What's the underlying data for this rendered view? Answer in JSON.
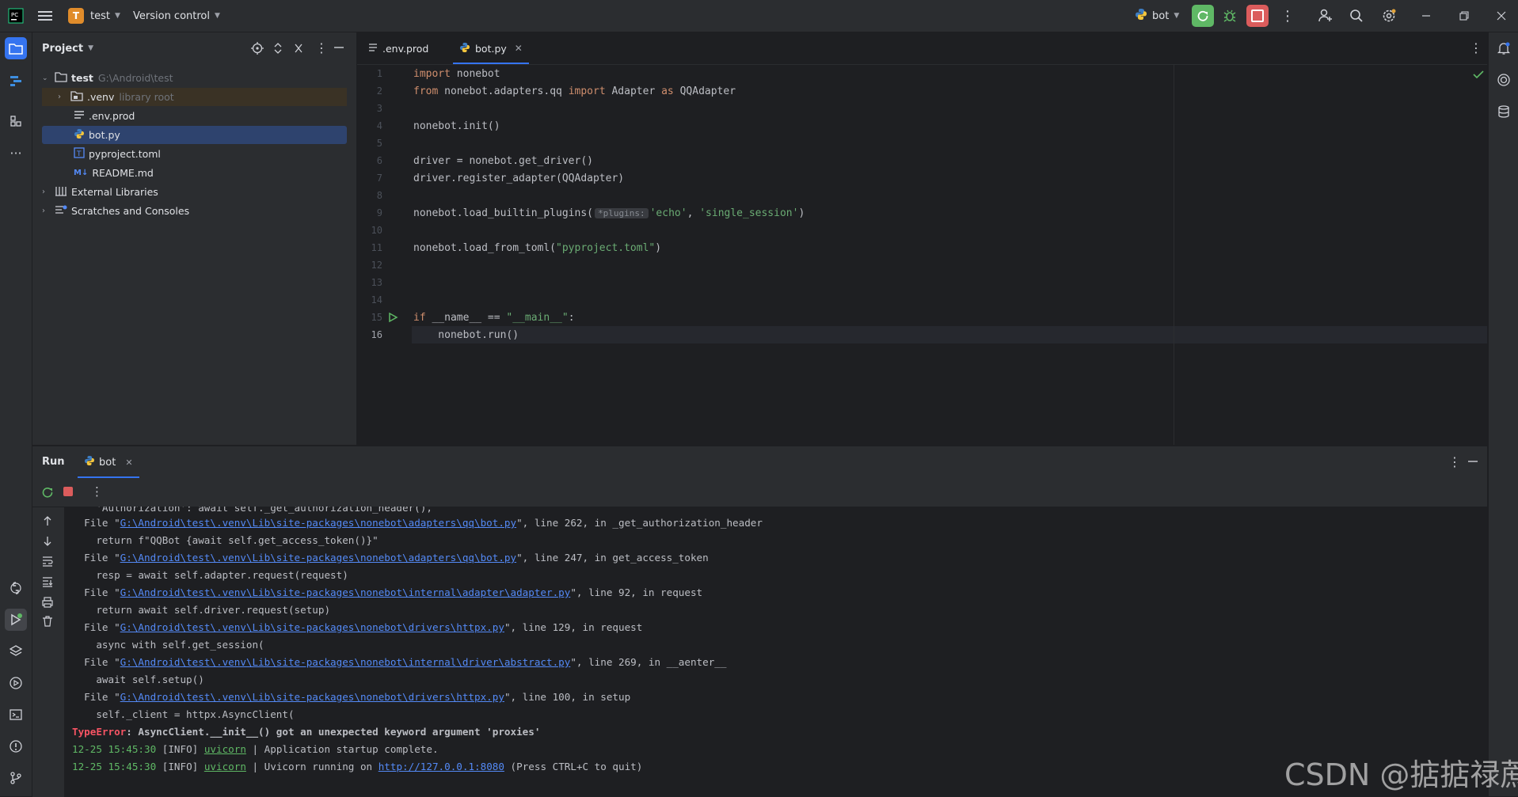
{
  "titlebar": {
    "project_initial": "T",
    "project_name": "test",
    "vcs_label": "Version control",
    "run_config": "bot"
  },
  "project_panel": {
    "title": "Project",
    "tree": [
      {
        "label": "test",
        "hint": "G:\\Android\\test"
      },
      {
        "label": ".venv",
        "hint": "library root"
      },
      {
        "label": ".env.prod"
      },
      {
        "label": "bot.py"
      },
      {
        "label": "pyproject.toml"
      },
      {
        "label": "README.md"
      },
      {
        "label": "External Libraries"
      },
      {
        "label": "Scratches and Consoles"
      }
    ]
  },
  "editor": {
    "tabs": [
      {
        "label": ".env.prod"
      },
      {
        "label": "bot.py"
      }
    ],
    "line_numbers": [
      "1",
      "2",
      "3",
      "4",
      "5",
      "6",
      "7",
      "8",
      "9",
      "10",
      "11",
      "12",
      "13",
      "14",
      "15",
      "16"
    ],
    "lines": {
      "l1_kw": "import",
      "l1_rest": " nonebot",
      "l2_kw": "from",
      "l2_mid": " nonebot.adapters.qq ",
      "l2_kw2": "import",
      "l2_mid2": " Adapter ",
      "l2_kw3": "as",
      "l2_end": " QQAdapter",
      "l4": "nonebot.init()",
      "l6": "driver = nonebot.get_driver()",
      "l7": "driver.register_adapter(QQAdapter)",
      "l9_a": "nonebot.load_builtin_plugins(",
      "l9_hint": "*plugins:",
      "l9_s1": "'echo'",
      "l9_c": ", ",
      "l9_s2": "'single_session'",
      "l9_end": ")",
      "l11_a": "nonebot.load_from_toml(",
      "l11_s": "\"pyproject.toml\"",
      "l11_end": ")",
      "l15_kw": "if",
      "l15_mid": " __name__ == ",
      "l15_s": "\"__main__\"",
      "l15_end": ":",
      "l16": "    nonebot.run()"
    }
  },
  "run_panel": {
    "title": "Run",
    "tab_label": "bot",
    "console": {
      "l0": "    'Authorization': await self._get_authorization_header(),",
      "f1_pre": "  File \"",
      "f1_path": "G:\\Android\\test\\.venv\\Lib\\site-packages\\nonebot\\adapters\\qq\\bot.py",
      "f1_post": "\", line 262, in _get_authorization_header",
      "l2": "    return f\"QQBot {await self.get_access_token()}\"",
      "f2_pre": "  File \"",
      "f2_path": "G:\\Android\\test\\.venv\\Lib\\site-packages\\nonebot\\adapters\\qq\\bot.py",
      "f2_post": "\", line 247, in get_access_token",
      "l4": "    resp = await self.adapter.request(request)",
      "f3_pre": "  File \"",
      "f3_path": "G:\\Android\\test\\.venv\\Lib\\site-packages\\nonebot\\internal\\adapter\\adapter.py",
      "f3_post": "\", line 92, in request",
      "l6": "    return await self.driver.request(setup)",
      "f4_pre": "  File \"",
      "f4_path": "G:\\Android\\test\\.venv\\Lib\\site-packages\\nonebot\\drivers\\httpx.py",
      "f4_post": "\", line 129, in request",
      "l8": "    async with self.get_session(",
      "f5_pre": "  File \"",
      "f5_path": "G:\\Android\\test\\.venv\\Lib\\site-packages\\nonebot\\internal\\driver\\abstract.py",
      "f5_post": "\", line 269, in __aenter__",
      "l10": "    await self.setup()",
      "f6_pre": "  File \"",
      "f6_path": "G:\\Android\\test\\.venv\\Lib\\site-packages\\nonebot\\drivers\\httpx.py",
      "f6_post": "\", line 100, in setup",
      "l12": "    self._client = httpx.AsyncClient(",
      "err_type": "TypeError",
      "err_msg": ": AsyncClient.__init__() got an unexpected keyword argument 'proxies'",
      "i1_time": "12-25 15:45:30",
      "i1_level": " [INFO] ",
      "i1_src": "uvicorn",
      "i1_msg": " | Application startup complete.",
      "i2_time": "12-25 15:45:30",
      "i2_level": " [INFO] ",
      "i2_src": "uvicorn",
      "i2_msg_a": " | Uvicorn running on ",
      "i2_url": "http://127.0.0.1:8080",
      "i2_msg_b": " (Press CTRL+C to quit)"
    }
  },
  "watermark": "CSDN @掂掂禄蔗",
  "colors": {
    "accent": "#3574f0",
    "run_green": "#5fb865",
    "stop_red": "#db5c5c",
    "keyword": "#cf8e6d",
    "string": "#6aab73",
    "link": "#548af7",
    "error": "#f75464"
  }
}
